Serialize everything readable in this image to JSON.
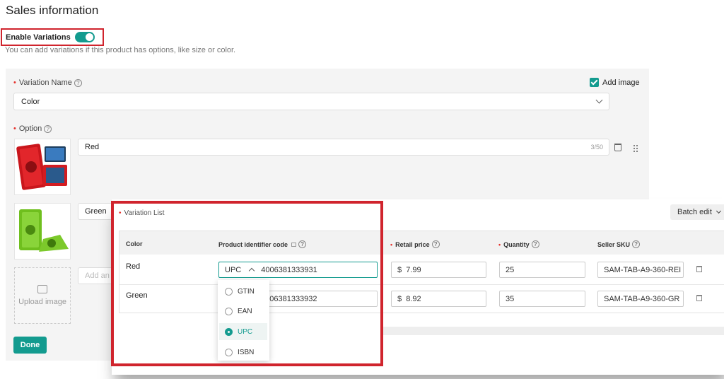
{
  "header": {
    "title": "Sales information"
  },
  "enable_variations": {
    "label": "Enable Variations",
    "enabled": true,
    "hint": "You can add variations if this product has options, like size or color."
  },
  "variation_name": {
    "label": "Variation Name",
    "value": "Color",
    "add_image_label": "Add image",
    "add_image_checked": true
  },
  "option": {
    "label": "Option",
    "items": [
      {
        "value": "Red",
        "counter": "3/50"
      },
      {
        "value": "Green"
      }
    ],
    "add_placeholder": "Add an",
    "upload_label": "Upload image"
  },
  "done_label": "Done",
  "variation_list": {
    "title": "Variation List",
    "batch_edit_label": "Batch edit",
    "columns": [
      "Color",
      "Product identifier code",
      "Retail price",
      "Quantity",
      "Seller SKU"
    ],
    "rows": [
      {
        "color": "Red",
        "id_type": "UPC",
        "id_code": "4006381333931",
        "currency": "$",
        "price": "7.99",
        "quantity": "25",
        "sku": "SAM-TAB-A9-360-REI"
      },
      {
        "color": "Green",
        "id_code": "4006381333932",
        "currency": "$",
        "price": "8.92",
        "quantity": "35",
        "sku": "SAM-TAB-A9-360-GR"
      }
    ],
    "dropdown_options": [
      "GTIN",
      "EAN",
      "UPC",
      "ISBN"
    ],
    "dropdown_selected": "UPC"
  },
  "colors": {
    "accent": "#139b8f",
    "highlight": "#d0242d",
    "required": "#e5322d"
  }
}
